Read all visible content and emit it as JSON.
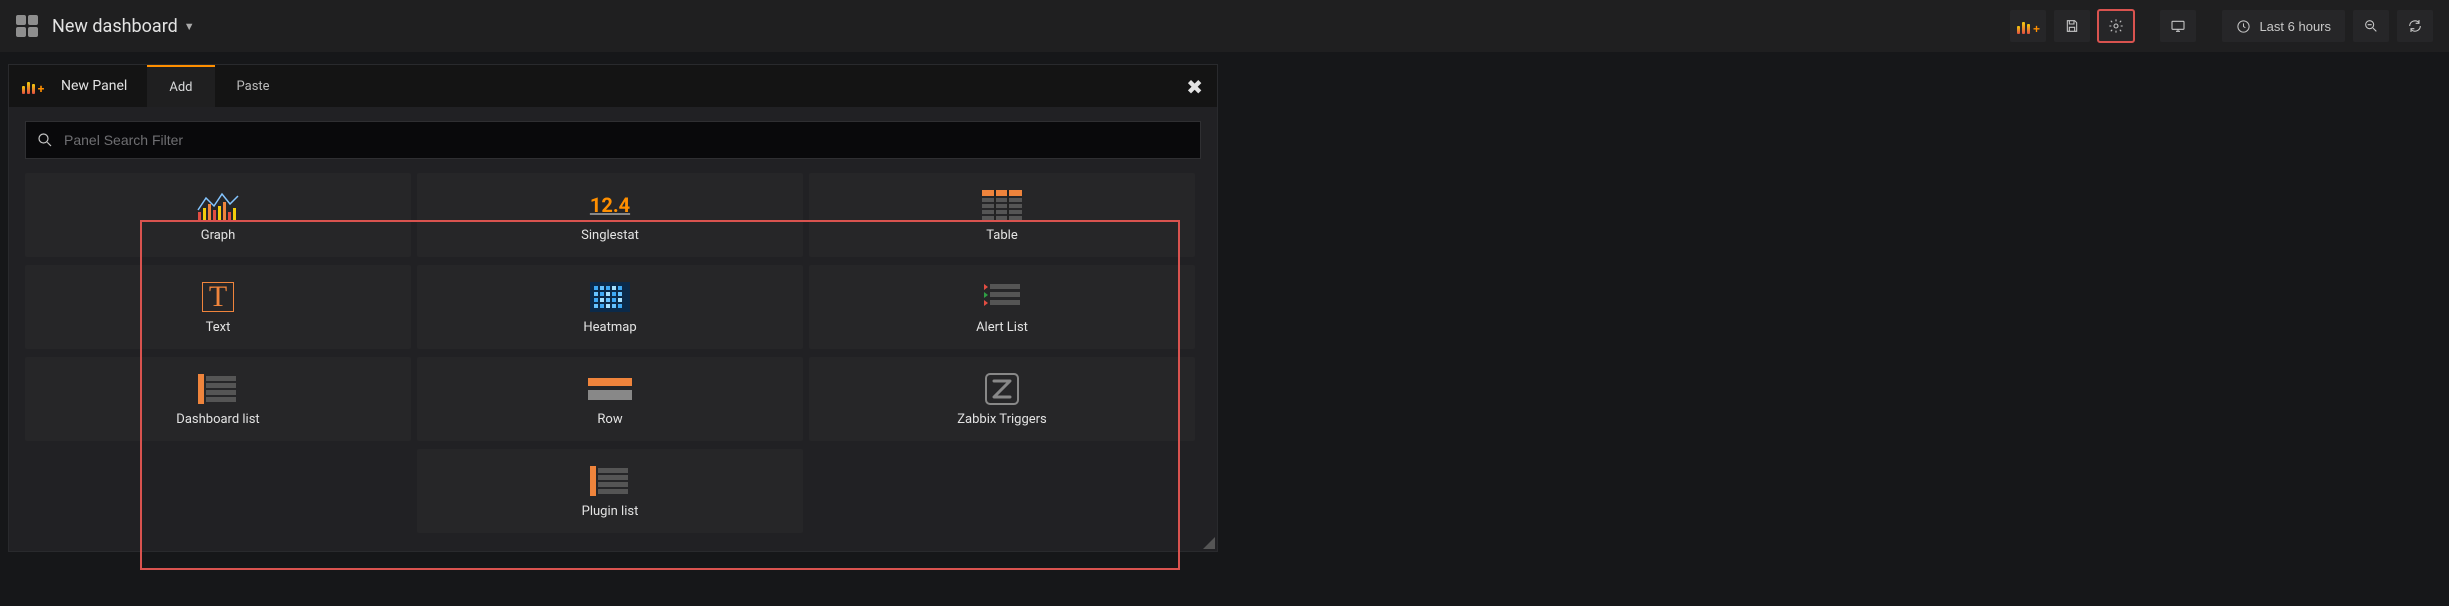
{
  "navbar": {
    "title": "New dashboard",
    "time_label": "Last 6 hours"
  },
  "panel_editor": {
    "title": "New Panel",
    "tabs": {
      "add": "Add",
      "paste": "Paste"
    },
    "search_placeholder": "Panel Search Filter"
  },
  "panel_types": {
    "graph": "Graph",
    "singlestat": "Singlestat",
    "singlestat_value": "12.4",
    "table": "Table",
    "text": "Text",
    "heatmap": "Heatmap",
    "alertlist": "Alert List",
    "dashlist": "Dashboard list",
    "row": "Row",
    "zabbix": "Zabbix Triggers",
    "pluginlist": "Plugin list"
  }
}
